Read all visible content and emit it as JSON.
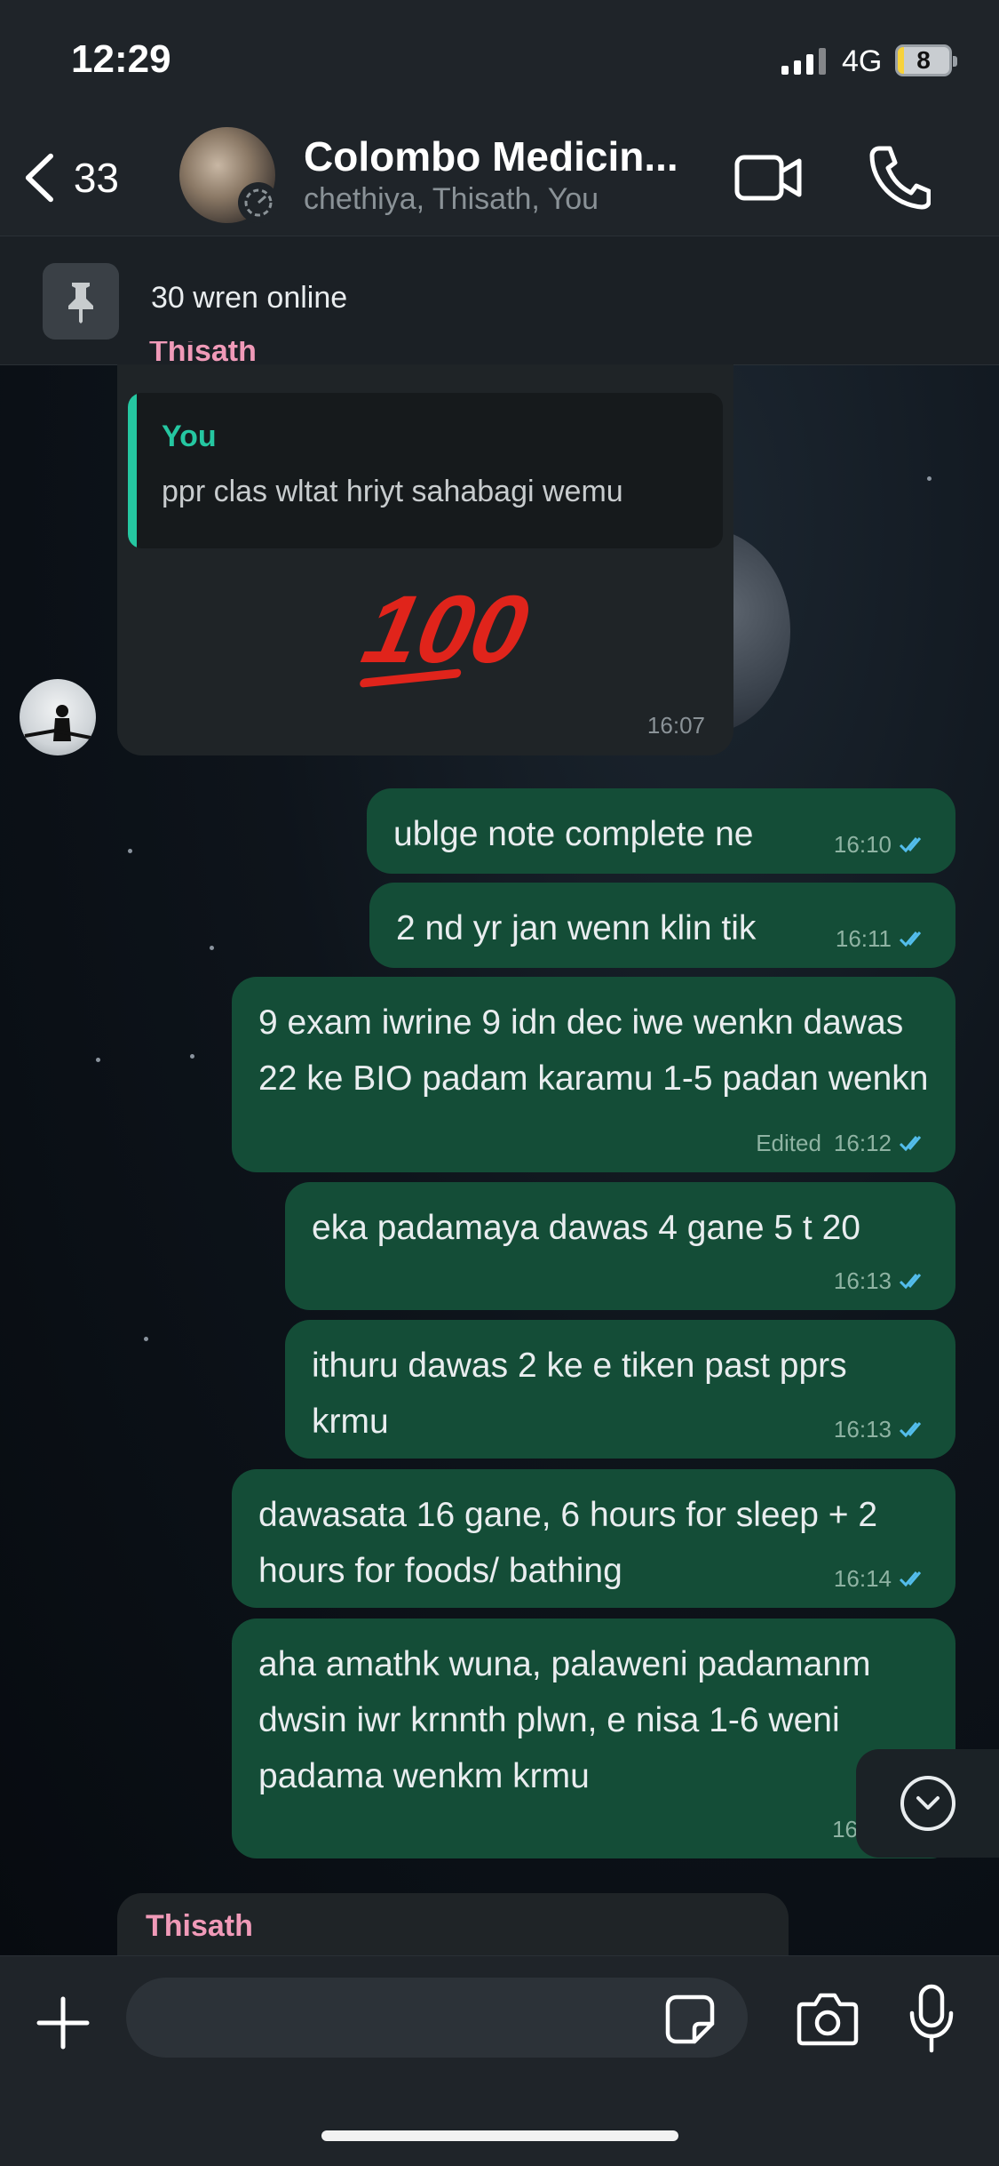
{
  "status_bar": {
    "time": "12:29",
    "network": "4G",
    "battery": "8"
  },
  "header": {
    "back_count": "33",
    "title": "Colombo Medicin...",
    "subtitle": "chethiya, Thisath, You"
  },
  "pinned": {
    "text": "30 wren online"
  },
  "messages": {
    "incoming_1": {
      "sender": "Thisath",
      "quote_author": "You",
      "quote_text": "ppr clas wltat hriyt sahabagi wemu",
      "body": "100",
      "time": "16:07"
    },
    "outgoing": [
      {
        "text": "ublge note complete ne",
        "time": "16:10",
        "edited": ""
      },
      {
        "text": "2 nd yr jan wenn klin tik",
        "time": "16:11",
        "edited": ""
      },
      {
        "text": "9 exam iwrine 9 idn dec iwe wenkn dawas 22 ke BIO padam karamu 1-5 padan wenkn",
        "time": "16:12",
        "edited": "Edited"
      },
      {
        "text": "eka padamaya dawas 4 gane 5 t 20",
        "time": "16:13",
        "edited": ""
      },
      {
        "text": "ithuru dawas 2 ke e tiken past pprs krmu",
        "time": "16:13",
        "edited": ""
      },
      {
        "text": "dawasata 16 gane, 6 hours for sleep + 2 hours for foods/ bathing",
        "time": "16:14",
        "edited": ""
      },
      {
        "text": "aha amathk wuna, palaweni padamanm dwsin iwr krnnth plwn, e nisa 1-6 weni padama wenkm krmu",
        "time": "16",
        "edited": ""
      }
    ],
    "incoming_2": {
      "sender": "Thisath"
    }
  },
  "composer": {
    "placeholder": ""
  },
  "colors": {
    "outgoing_bubble": "#144d37",
    "incoming_bubble": "#1f2427",
    "accent_green": "#25c7a1",
    "sender_pink": "#f09ab8",
    "read_ticks": "#53bdeb"
  },
  "icons": [
    "back-chevron-icon",
    "group-avatar",
    "video-call-icon",
    "phone-icon",
    "pin-icon",
    "read-receipt-icon",
    "chevron-down-icon",
    "plus-icon",
    "sticker-icon",
    "camera-icon",
    "microphone-icon"
  ]
}
